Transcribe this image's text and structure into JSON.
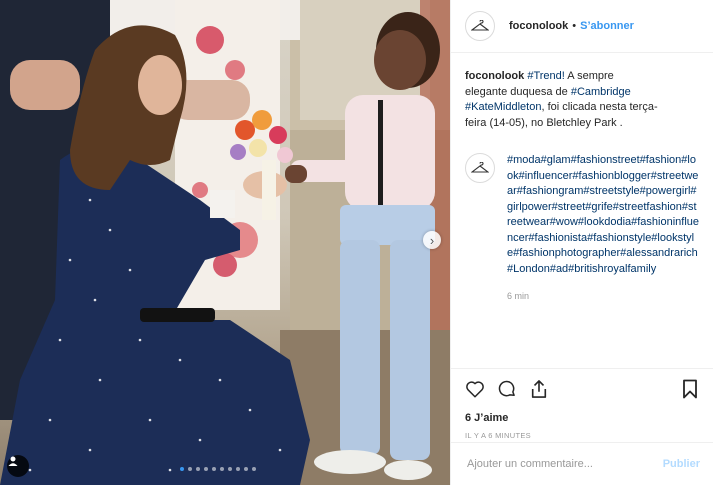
{
  "post": {
    "username": "foconolook",
    "separator": "•",
    "follow_label": "S’abonner",
    "caption_username": "foconolook",
    "caption_parts": [
      {
        "type": "tag",
        "text": "#Trend!"
      },
      {
        "type": "text",
        "text": " A sempre elegante duquesa de "
      },
      {
        "type": "tag",
        "text": "#Cambridge"
      },
      {
        "type": "text",
        "text": " "
      },
      {
        "type": "tag",
        "text": "#KateMiddleton"
      },
      {
        "type": "text",
        "text": ", foi clicada nesta terça-feira (14-05), no Bletchley Park ."
      }
    ],
    "hashtags": "#moda#glam#fashionstreet#fashion#look#influencer#fashionblogger#streetwear#fashiongram#streetstyle#powergirl#girlpower#street#grife#streetfashion#streetwear#wow#lookdodia#fashioninfluencer#fashionista#fashionstyle#lookstyle#fashionphotographer#alessandrarich#London#ad#britishroyalfamily",
    "time_ago": "6 min",
    "likes": "6 J’aime",
    "date": "IL Y A 6 MINUTES",
    "comment_placeholder": "Ajouter un commentaire...",
    "publish_label": "Publier",
    "carousel_count": 10,
    "carousel_active": 0
  },
  "icons": {
    "avatar": "hanger-icon",
    "like": "heart-icon",
    "comment": "comment-icon",
    "share": "share-icon",
    "save": "bookmark-icon",
    "next": "chevron-right-icon",
    "tagged": "user-icon"
  },
  "colors": {
    "link": "#003569",
    "follow": "#3897f0",
    "publish_disabled": "#b3dbff",
    "muted": "#999999"
  }
}
